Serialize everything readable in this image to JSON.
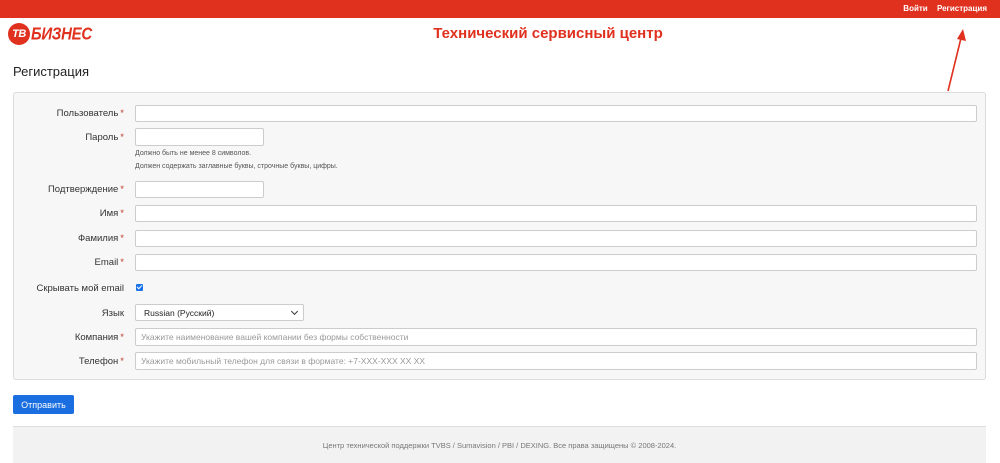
{
  "header": {
    "login_label": "Войти",
    "register_label": "Регистрация",
    "site_title": "Технический сервисный центр",
    "logo": {
      "badge": "ТВ",
      "word": "БИЗНЕС"
    }
  },
  "page_title": "Регистрация",
  "form": {
    "username_label": "Пользователь",
    "password_label": "Пароль",
    "password_hint_1": "Должно быть не менее 8 символов.",
    "password_hint_2": "Должен содержать заглавные буквы, строчные буквы, цифры.",
    "confirm_label": "Подтверждение",
    "firstname_label": "Имя",
    "lastname_label": "Фамилия",
    "email_label": "Email",
    "hide_email_label": "Скрывать мой email",
    "hide_email_checked": true,
    "language_label": "Язык",
    "language_value": "Russian (Русский)",
    "company_label": "Компания",
    "company_placeholder": "Укажите наименование вашей компании без формы собственности",
    "phone_label": "Телефон",
    "phone_placeholder": "Укажите мобильный телефон для связи в формате: +7-XXX-XXX XX XX",
    "required_mark": "*"
  },
  "submit_label": "Отправить",
  "footer_text": "Центр технической поддержки TVBS / Sumavision / PBI / DEXING. Все права защищены © 2008-2024.",
  "colors": {
    "brand": "#e0301e",
    "button": "#1a6ee0"
  }
}
